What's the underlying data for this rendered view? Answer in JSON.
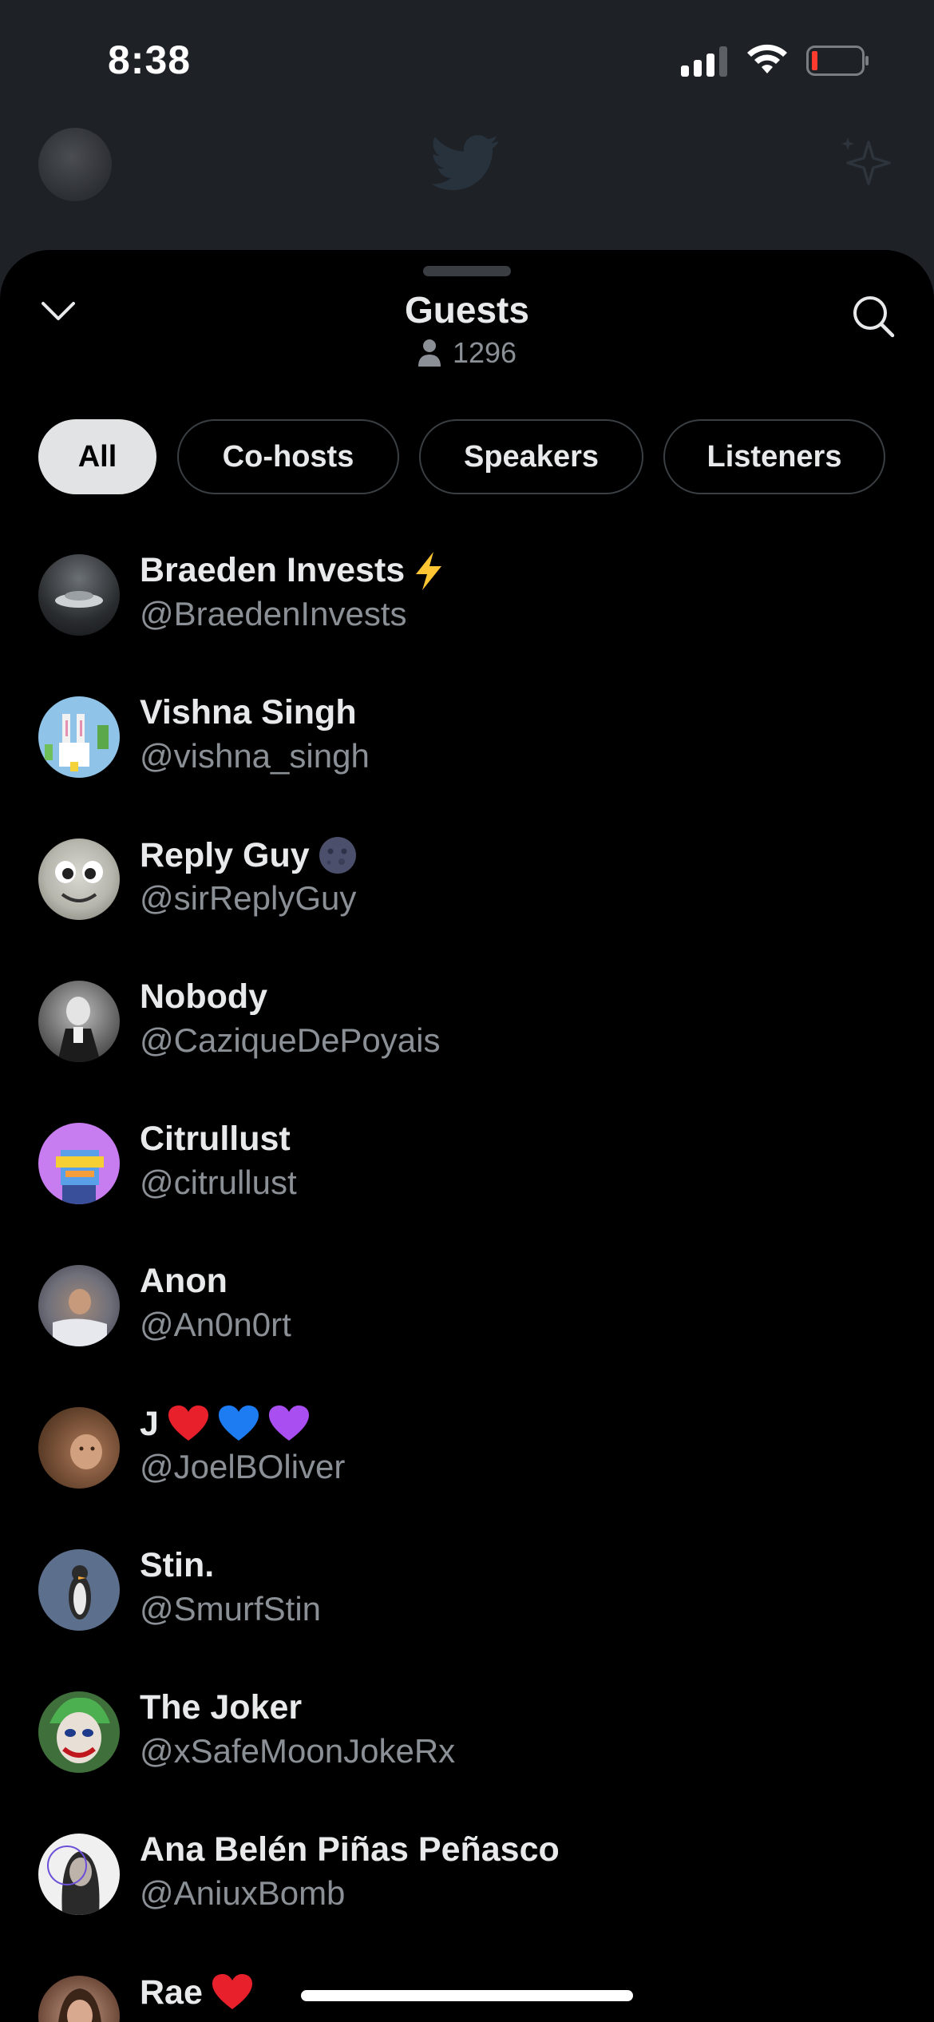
{
  "status_bar": {
    "time": "8:38"
  },
  "sheet": {
    "title": "Guests",
    "guest_count": "1296",
    "tabs": [
      {
        "label": "All",
        "active": true
      },
      {
        "label": "Co-hosts",
        "active": false
      },
      {
        "label": "Speakers",
        "active": false
      },
      {
        "label": "Listeners",
        "active": false
      }
    ],
    "guests": [
      {
        "name": "Braeden Invests",
        "handle": "@BraedenInvests",
        "emoji": "lightning"
      },
      {
        "name": "Vishna Singh",
        "handle": "@vishna_singh",
        "emoji": ""
      },
      {
        "name": "Reply Guy",
        "handle": "@sirReplyGuy",
        "emoji": "new-moon-face"
      },
      {
        "name": "Nobody",
        "handle": "@CaziqueDePoyais",
        "emoji": ""
      },
      {
        "name": "Citrullust",
        "handle": "@citrullust",
        "emoji": ""
      },
      {
        "name": "Anon",
        "handle": "@An0n0rt",
        "emoji": ""
      },
      {
        "name": "J",
        "handle": "@JoelBOliver",
        "emoji": "hearts-red-blue-purple"
      },
      {
        "name": "Stin.",
        "handle": "@SmurfStin",
        "emoji": ""
      },
      {
        "name": "The Joker",
        "handle": "@xSafeMoonJokeRx",
        "emoji": ""
      },
      {
        "name": "Ana Belén Piñas Peñasco",
        "handle": "@AniuxBomb",
        "emoji": ""
      },
      {
        "name": "Rae",
        "handle": "",
        "emoji": "red-heart"
      }
    ]
  },
  "colors": {
    "sheet_bg": "#000000",
    "page_bg": "#1e2126",
    "secondary_text": "#8b9096",
    "active_tab_bg": "#e1e3e4"
  }
}
